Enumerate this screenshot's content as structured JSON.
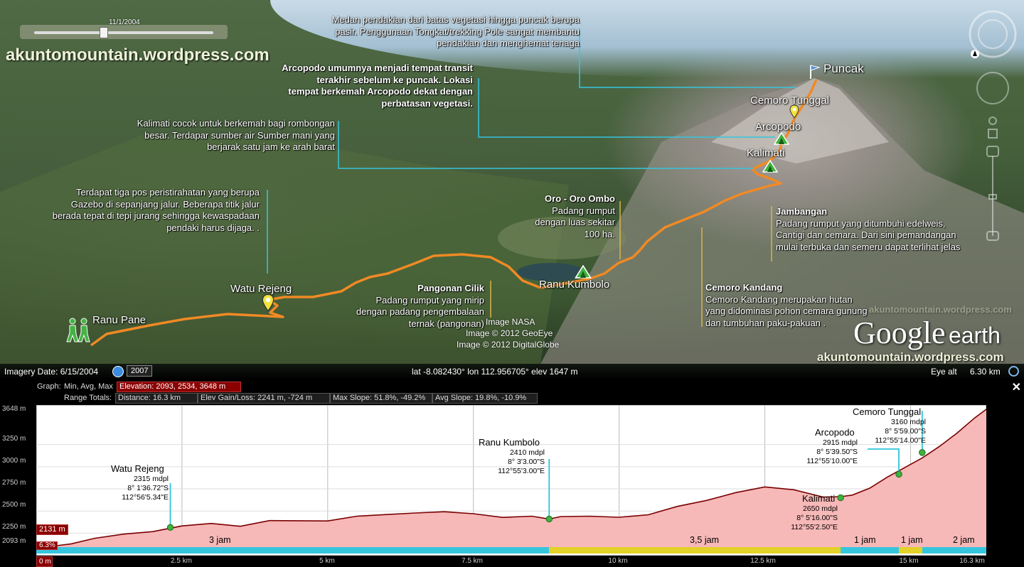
{
  "map": {
    "time_slider": {
      "date": "11/1/2004"
    },
    "brand_top": "akuntomountain.wordpress.com",
    "brand_bottom": "akuntomountain.wordpress.com",
    "watermark": "akuntomountain.wordpress.com",
    "logo": {
      "word1": "Google",
      "word2": "earth"
    },
    "credits": [
      "Image NASA",
      "Image © 2012 GeoEye",
      "Image © 2012 DigitalGlobe"
    ],
    "places": {
      "puncak": "Puncak",
      "cemoro_tunggal": "Cemoro Tunggal",
      "arcopodo": "Arcopodo",
      "kalimati": "Kalimati",
      "watu_rejeng": "Watu Rejeng",
      "ranu_pane": "Ranu Pane",
      "ranu_kumbolo": "Ranu Kumbolo"
    },
    "annotations": {
      "summit": [
        "Medan pendakian  dari batas vegetasi hingga puncak berupa",
        "pasir. Penggunaan Tongkat/trekking Pole sangat membantu",
        "pendakian dan menghemat tenaga"
      ],
      "arcopodo": [
        "Arcopodo  umumnya menjadi tempat transit",
        "terakhir sebelum  ke puncak.  Lokasi",
        "tempat  berkemah Arcopodo dekat dengan",
        "perbatasan vegetasi."
      ],
      "kalimati": [
        "Kalimati cocok untuk berkemah bagi rombongan",
        "besar. Terdapar sumber air  Sumber mani yang",
        "berjarak satu jam ke arah barat"
      ],
      "watu_rejeng": [
        "Terdapat tiga pos peristirahatan yang berupa",
        "Gazebo di sepanjang jalur.  Beberapa titik jalur",
        "berada tepat di tepi jurang sehingga kewaspadaan",
        "pendaki harus dijaga. ."
      ],
      "oro_title": "Oro - Oro  Ombo",
      "oro": [
        "Padang rumput",
        "dengan luas sekitar",
        "100 ha."
      ],
      "pangonan_title": "Pangonan Cilik",
      "pangonan": [
        "Padang rumput yang mirip",
        "dengan padang pengembalaan",
        "ternak (pangonan)"
      ],
      "jambangan_title": "Jambangan",
      "jambangan": [
        "Padang rumput yang ditumbuhi edelweis,",
        "Cantigi dan cemara. Dari sini pemandangan",
        "mulai terbuka dan semeru dapat terlihat jelas"
      ],
      "cemoro_kandang_title": "Cemoro Kandang",
      "cemoro_kandang": [
        "Cemoro Kandang merupakan hutan",
        "yang didominasi pohon cemara gunung",
        "dan tumbuhan paku-pakuan ."
      ]
    }
  },
  "status": {
    "imagery_label": "Imagery Date: 6/15/2004",
    "year_badge": "2007",
    "coords": "lat   -8.082430°  lon  112.956705°  elev  1647 m",
    "eye_label": "Eye alt",
    "eye_value": "6.30 km"
  },
  "profile": {
    "graph_label": "Graph:",
    "graph_modes": "Min, Avg, Max",
    "elevation_box": "Elevation: 2093, 2534, 3648 m",
    "range_label": "Range Totals:",
    "distance_box": "Distance: 16.3 km",
    "gain_box": "Elev Gain/Loss: 2241 m, -724 m",
    "maxslope_box": "Max Slope: 51.8%, -49.2%",
    "avgslope_box": "Avg Slope: 19.8%, -10.9%",
    "close_label": "✕",
    "current_elev": "2131 m",
    "current_slope": "6.3%",
    "start_label": "0 m",
    "y_ticks": [
      "3648 m",
      "3250 m",
      "3000 m",
      "2750 m",
      "2500 m",
      "2250 m",
      "2093 m"
    ],
    "x_ticks": [
      "2.5 km",
      "5 km",
      "7.5 km",
      "10 km",
      "12.5 km",
      "15 km",
      "16.3 km"
    ],
    "points": [
      {
        "name": "Watu Rejeng",
        "lines": [
          "2315 mdpl",
          "8° 1'36.72\"S",
          "112°56'5.34\"E"
        ]
      },
      {
        "name": "Ranu Kumbolo",
        "lines": [
          "2410 mdpl",
          "8° 3'3.00\"S",
          "112°55'3.00\"E"
        ]
      },
      {
        "name": "Kalimati",
        "lines": [
          "2650 mdpl",
          "8° 5'16.00\"S",
          "112°55'2.50\"E"
        ]
      },
      {
        "name": "Arcopodo",
        "lines": [
          "2915 mdpl",
          "8° 5'39.50\"S",
          "112°55'10.00\"E"
        ]
      },
      {
        "name": "Cemoro Tunggal",
        "lines": [
          "3160 mdpl",
          "8° 5'59.00\"S",
          "112°55'14.00\"E"
        ]
      }
    ],
    "durations": [
      "3 jam",
      "3,5 jam",
      "1 jam",
      "1 jam",
      "2 jam"
    ],
    "colors": {
      "fill": "#f7b8b8",
      "line": "#7a0000",
      "marker": "#3fb23f",
      "leader": "#2fc4d9",
      "seg_cyan": "#35c6dd",
      "seg_yellow": "#e3d227"
    }
  },
  "chart_data": {
    "type": "area",
    "title": "",
    "xlabel": "",
    "ylabel": "",
    "xlim": [
      0,
      16.3
    ],
    "ylim": [
      2093,
      3648
    ],
    "x": [
      0,
      0.3,
      0.6,
      1.0,
      1.5,
      2.0,
      2.5,
      3.0,
      3.5,
      4.0,
      4.5,
      5.0,
      5.5,
      6.0,
      6.5,
      7.0,
      7.5,
      8.0,
      8.5,
      8.8,
      9.0,
      9.5,
      10.0,
      10.5,
      11.0,
      11.5,
      12.0,
      12.5,
      13.0,
      13.5,
      13.8,
      14.0,
      14.3,
      14.6,
      14.9,
      15.2,
      15.5,
      15.8,
      16.1,
      16.3
    ],
    "y": [
      2110,
      2105,
      2130,
      2180,
      2240,
      2280,
      2320,
      2360,
      2340,
      2380,
      2390,
      2400,
      2430,
      2460,
      2490,
      2480,
      2470,
      2440,
      2430,
      2410,
      2450,
      2430,
      2430,
      2470,
      2540,
      2620,
      2720,
      2760,
      2740,
      2670,
      2650,
      2680,
      2770,
      2870,
      2990,
      3110,
      3230,
      3380,
      3550,
      3648
    ],
    "series": [
      {
        "name": "Watu Rejeng",
        "x": [
          2.3
        ],
        "y": [
          2315
        ]
      },
      {
        "name": "Ranu Kumbolo",
        "x": [
          8.8
        ],
        "y": [
          2410
        ]
      },
      {
        "name": "Kalimati",
        "x": [
          13.8
        ],
        "y": [
          2650
        ]
      },
      {
        "name": "Arcopodo",
        "x": [
          14.8
        ],
        "y": [
          2915
        ]
      },
      {
        "name": "Cemoro Tunggal",
        "x": [
          15.2
        ],
        "y": [
          3160
        ]
      }
    ],
    "segments": [
      {
        "label": "3 jam",
        "x": [
          0,
          8.8
        ],
        "color": "#35c6dd"
      },
      {
        "label": "3,5 jam",
        "x": [
          8.8,
          13.8
        ],
        "color": "#e3d227"
      },
      {
        "label": "1 jam",
        "x": [
          13.8,
          14.8
        ],
        "color": "#35c6dd"
      },
      {
        "label": "1 jam",
        "x": [
          14.8,
          15.2
        ],
        "color": "#e3d227"
      },
      {
        "label": "2 jam",
        "x": [
          15.2,
          16.3
        ],
        "color": "#35c6dd"
      }
    ]
  }
}
